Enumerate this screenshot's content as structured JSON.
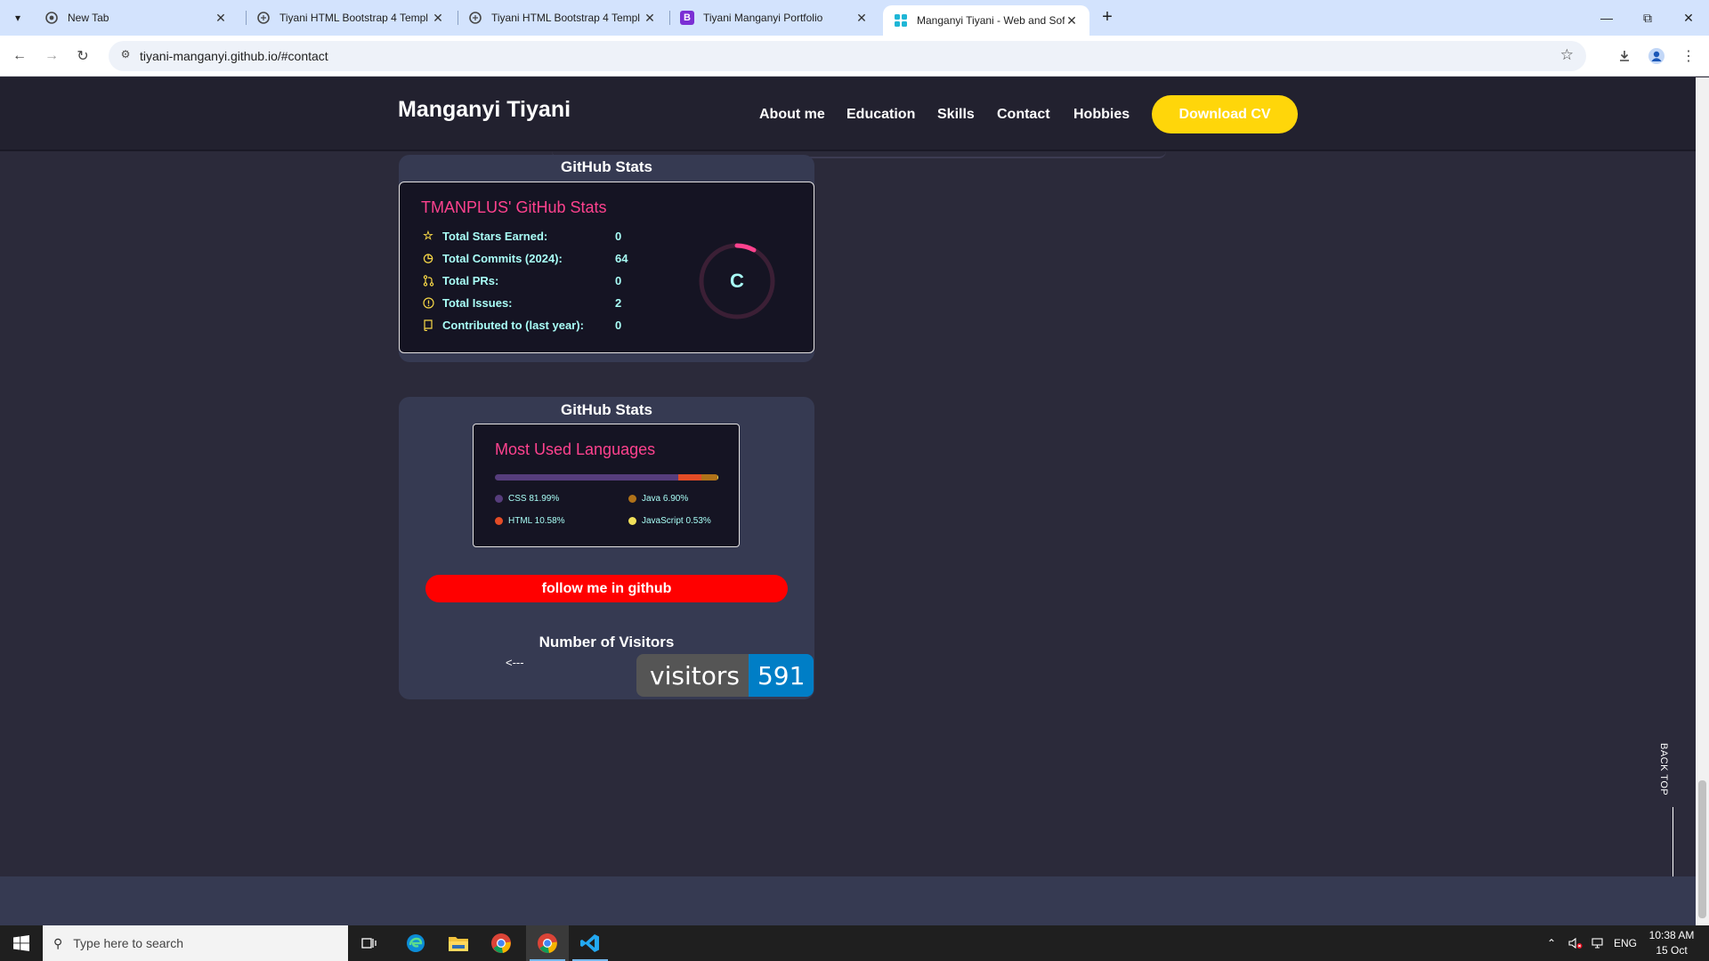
{
  "browser": {
    "tabs": [
      {
        "title": "New Tab",
        "icon": "chrome-icon"
      },
      {
        "title": "Tiyani HTML Bootstrap 4 Templ",
        "icon": "github-icon"
      },
      {
        "title": "Tiyani HTML Bootstrap 4 Templ",
        "icon": "github-icon"
      },
      {
        "title": "Tiyani Manganyi Portfolio",
        "icon": "bootstrap-icon"
      },
      {
        "title": "Manganyi Tiyani - Web and Sof",
        "icon": "site-icon",
        "active": true
      }
    ],
    "url": "tiyani-manganyi.github.io/#contact"
  },
  "site": {
    "brand": "Manganyi Tiyani",
    "nav": [
      "About me",
      "Education",
      "Skills",
      "Contact",
      "Hobbies"
    ],
    "cv_button": "Download CV",
    "accent_color": "#ffd60a"
  },
  "stats_card": {
    "heading": "GitHub Stats",
    "title": "TMANPLUS' GitHub Stats",
    "rows": [
      {
        "label": "Total Stars Earned:",
        "value": "0",
        "icon": "star-icon"
      },
      {
        "label": "Total Commits (2024):",
        "value": "64",
        "icon": "history-icon"
      },
      {
        "label": "Total PRs:",
        "value": "0",
        "icon": "pull-request-icon"
      },
      {
        "label": "Total Issues:",
        "value": "2",
        "icon": "issue-icon"
      },
      {
        "label": "Contributed to (last year):",
        "value": "0",
        "icon": "repo-icon"
      }
    ],
    "rank": "C",
    "colors": {
      "title": "#fe428e",
      "text": "#a9fef7",
      "icon": "#f8d847",
      "bg": "#151423"
    }
  },
  "languages_card": {
    "heading": "GitHub Stats",
    "title": "Most Used Languages",
    "languages": [
      {
        "name": "CSS",
        "percent": 81.99,
        "label": "CSS 81.99%",
        "color": "#563d7c"
      },
      {
        "name": "HTML",
        "percent": 10.58,
        "label": "HTML 10.58%",
        "color": "#e34c26"
      },
      {
        "name": "Java",
        "percent": 6.9,
        "label": "Java 6.90%",
        "color": "#b07219"
      },
      {
        "name": "JavaScript",
        "percent": 0.53,
        "label": "JavaScript 0.53%",
        "color": "#f1e05a"
      }
    ],
    "follow_button": "follow me in github",
    "visitors_heading": "Number of Visitors",
    "arrow": "<---",
    "badge_label": "visitors",
    "badge_count": "591"
  },
  "back_top": "BACK TOP",
  "taskbar": {
    "search_placeholder": "Type here to search",
    "apps": [
      "task-view-icon",
      "edge-icon",
      "file-explorer-icon",
      "chrome-icon",
      "chrome-icon",
      "vscode-icon"
    ],
    "language": "ENG",
    "time": "10:38 AM",
    "date": "15 Oct 2024"
  }
}
